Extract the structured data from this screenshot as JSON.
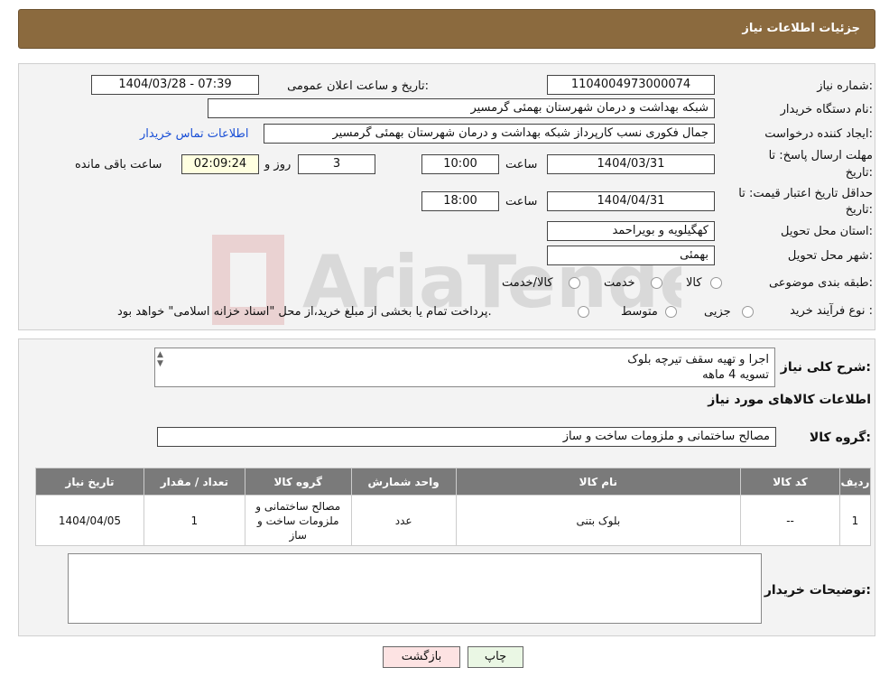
{
  "header": {
    "title": "جزئیات اطلاعات نیاز"
  },
  "fields": {
    "need_number_label": "شماره نیاز:",
    "need_number": "1104004973000074",
    "announce_label": "تاریخ و ساعت اعلان عمومی:",
    "announce_value": "1404/03/28 - 07:39",
    "buyer_org_label": "نام دستگاه خریدار:",
    "buyer_org": "شبکه بهداشت و درمان شهرستان بهمئی گرمسیر",
    "creator_label": "ایجاد کننده درخواست:",
    "creator": "جمال  فکوری نسب کارپرداز شبکه بهداشت و درمان شهرستان بهمئی گرمسیر",
    "contact_link": "اطلاعات تماس خریدار",
    "deadline_label_1": "مهلت ارسال پاسخ: تا",
    "deadline_label_2": "تاریخ:",
    "deadline_date": "1404/03/31",
    "time_label": "ساعت",
    "deadline_time": "10:00",
    "days_value": "3",
    "days_label": "روز و",
    "remaining_time": "02:09:24",
    "remaining_label": "ساعت باقی مانده",
    "validity_label_1": "حداقل تاریخ اعتبار قیمت: تا",
    "validity_label_2": "تاریخ:",
    "validity_date": "1404/04/31",
    "validity_time_label": "ساعت",
    "validity_time": "18:00",
    "province_label": "استان محل تحویل:",
    "province": "کهگیلویه و بویراحمد",
    "city_label": "شهر محل تحویل:",
    "city": "بهمئی",
    "category_label": "طبقه بندی موضوعی:",
    "category_options": [
      "کالا",
      "خدمت",
      "کالا/خدمت"
    ],
    "process_label": "نوع فرآیند خرید :",
    "process_options": [
      "جزیی",
      "متوسط"
    ],
    "process_note": "پرداخت تمام یا بخشی از مبلغ خرید،از محل \"اسناد خزانه اسلامی\" خواهد بود."
  },
  "description": {
    "label": "شرح کلی نیاز:",
    "line1": "اجرا و تهیه سقف تیرچه بلوک",
    "line2": "تسویه 4 ماهه"
  },
  "goods": {
    "section_title": "اطلاعات کالاهای مورد نیاز",
    "group_label": "گروه کالا:",
    "group_value": "مصالح ساختمانی و ملزومات ساخت و ساز",
    "columns": [
      "ردیف",
      "کد کالا",
      "نام کالا",
      "واحد شمارش",
      "گروه کالا",
      "تعداد / مقدار",
      "تاریخ نیاز"
    ],
    "rows": [
      {
        "row": "1",
        "code": "--",
        "name": "بلوک بتنی",
        "unit": "عدد",
        "group": "مصالح ساختمانی و ملزومات ساخت و ساز",
        "qty": "1",
        "date": "1404/04/05"
      }
    ]
  },
  "buyer_notes": {
    "label": "توضیحات خریدار:"
  },
  "buttons": {
    "print": "چاپ",
    "back": "بازگشت"
  },
  "watermark": {
    "text": "AriaTender.neT"
  },
  "colors": {
    "header": "#8b6a3e",
    "remaining_bg": "#ffffe0",
    "table_header": "#7a7a7a",
    "print_btn": "#eaf7e4",
    "back_btn": "#fde3e3",
    "link": "#1a4fd6"
  }
}
